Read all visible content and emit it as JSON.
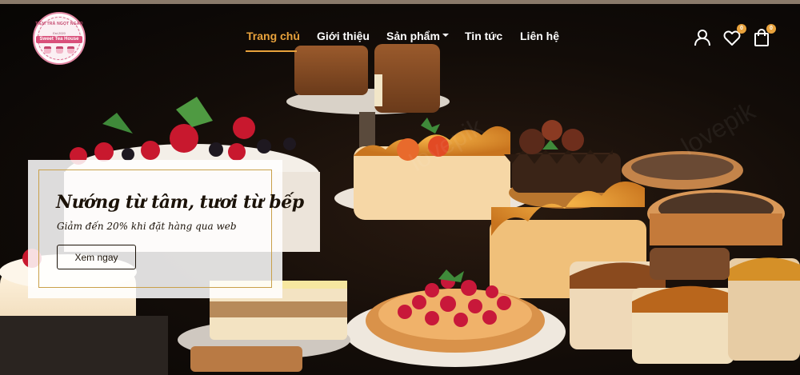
{
  "brand": {
    "arc_text": "TIỆM TRÀ NGỌT NGÀO",
    "established": "Est.2020",
    "name": "Sweet Tea House"
  },
  "nav": {
    "items": [
      {
        "label": "Trang chủ",
        "active": true
      },
      {
        "label": "Giới thiệu",
        "active": false
      },
      {
        "label": "Sản phẩm",
        "active": false,
        "has_dropdown": true
      },
      {
        "label": "Tin tức",
        "active": false
      },
      {
        "label": "Liên hệ",
        "active": false
      }
    ]
  },
  "header_icons": {
    "account": {
      "icon": "user-icon"
    },
    "wishlist": {
      "icon": "heart-icon",
      "count": "0"
    },
    "cart": {
      "icon": "shopping-bag-icon",
      "count": "0"
    }
  },
  "banner": {
    "title": "Nướng từ tâm, tươi từ bếp",
    "subtitle": "Giảm đến 20% khi đặt hàng qua web",
    "button_label": "Xem ngay"
  },
  "colors": {
    "accent": "#e8a23c",
    "nav_text": "#ffffff",
    "background": "#0d0b09",
    "banner_bg": "rgba(255,255,255,0.86)"
  }
}
